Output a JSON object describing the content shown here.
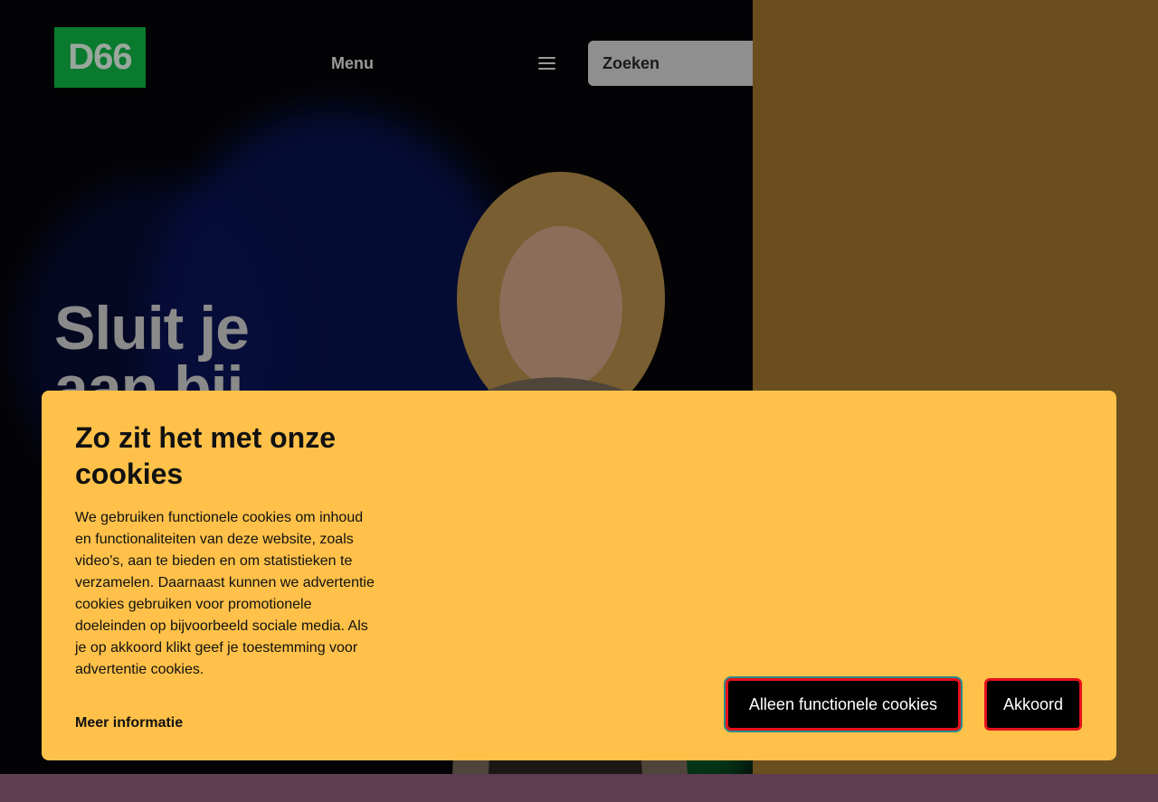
{
  "header": {
    "logo_text": "D66",
    "menu_label": "Menu",
    "menu_icon": "hamburger-icon",
    "search_placeholder": "Zoeken",
    "search_icon": "search-icon"
  },
  "hero": {
    "title": "Sluit je aan bij"
  },
  "cookie_banner": {
    "title": "Zo zit het met onze cookies",
    "body": "We gebruiken functionele cookies om inhoud en functionaliteiten van deze website, zoals video's, aan te bieden en om statistieken te verzamelen. Daarnaast kunnen we advertentie cookies gebruiken voor promotionele doeleinden op bijvoorbeeld sociale media. Als je op akkoord klikt geef je toestemming voor advertentie cookies.",
    "more_info_label": "Meer informatie",
    "functional_only_label": "Alleen functionele cookies",
    "accept_label": "Akkoord"
  },
  "colors": {
    "banner": "#ffc149",
    "logo_green": "#0a7a2e",
    "button_border": "#e5121d",
    "right_panel": "#6a4e1e",
    "bottom_strip": "#5f3d50"
  }
}
